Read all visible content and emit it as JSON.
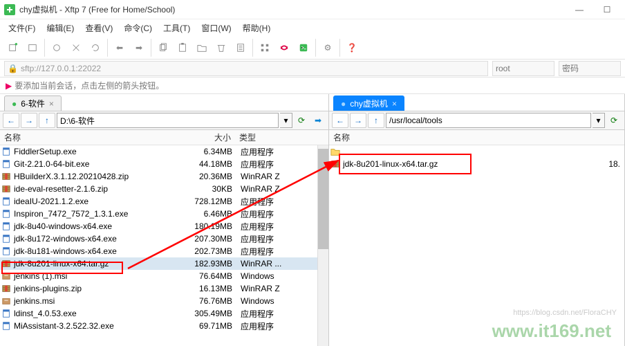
{
  "window": {
    "title": "chy虚拟机 - Xftp 7 (Free for Home/School)"
  },
  "menu": {
    "file": "文件(F)",
    "edit": "编辑(E)",
    "view": "查看(V)",
    "cmd": "命令(C)",
    "tools": "工具(T)",
    "window": "窗口(W)",
    "help": "帮助(H)"
  },
  "address": {
    "url": "sftp://127.0.0.1:22022",
    "user_placeholder": "root",
    "pass_placeholder": "密码"
  },
  "hint": "要添加当前会话，点击左侧的箭头按钮。",
  "left": {
    "tab": "6-软件",
    "path": "D:\\6-软件",
    "cols": {
      "name": "名称",
      "size": "大小",
      "type": "类型"
    },
    "files": [
      {
        "ico": "app",
        "name": "FiddlerSetup.exe",
        "size": "6.34MB",
        "type": "应用程序"
      },
      {
        "ico": "app",
        "name": "Git-2.21.0-64-bit.exe",
        "size": "44.18MB",
        "type": "应用程序"
      },
      {
        "ico": "rar",
        "name": "HBuilderX.3.1.12.20210428.zip",
        "size": "20.36MB",
        "type": "WinRAR Z"
      },
      {
        "ico": "rar",
        "name": "ide-eval-resetter-2.1.6.zip",
        "size": "30KB",
        "type": "WinRAR Z"
      },
      {
        "ico": "app",
        "name": "ideaIU-2021.1.2.exe",
        "size": "728.12MB",
        "type": "应用程序"
      },
      {
        "ico": "app",
        "name": "Inspiron_7472_7572_1.3.1.exe",
        "size": "6.46MB",
        "type": "应用程序"
      },
      {
        "ico": "app",
        "name": "jdk-8u40-windows-x64.exe",
        "size": "180.19MB",
        "type": "应用程序"
      },
      {
        "ico": "app",
        "name": "jdk-8u172-windows-x64.exe",
        "size": "207.30MB",
        "type": "应用程序"
      },
      {
        "ico": "app",
        "name": "jdk-8u181-windows-x64.exe",
        "size": "202.73MB",
        "type": "应用程序"
      },
      {
        "ico": "rar",
        "name": "jdk-8u201-linux-x64.tar.gz",
        "size": "182.93MB",
        "type": "WinRAR ...",
        "sel": true
      },
      {
        "ico": "msi",
        "name": "jenkins (1).msi",
        "size": "76.64MB",
        "type": "Windows"
      },
      {
        "ico": "rar",
        "name": "jenkins-plugins.zip",
        "size": "16.13MB",
        "type": "WinRAR Z"
      },
      {
        "ico": "msi",
        "name": "jenkins.msi",
        "size": "76.76MB",
        "type": "Windows"
      },
      {
        "ico": "app",
        "name": "ldinst_4.0.53.exe",
        "size": "305.49MB",
        "type": "应用程序"
      },
      {
        "ico": "app",
        "name": "MiAssistant-3.2.522.32.exe",
        "size": "69.71MB",
        "type": "应用程序"
      }
    ]
  },
  "right": {
    "tab": "chy虚拟机",
    "path": "/usr/local/tools",
    "cols": {
      "name": "名称",
      "size_cut": "18."
    },
    "files": [
      {
        "ico": "folder",
        "name": ""
      },
      {
        "ico": "rar",
        "name": "jdk-8u201-linux-x64.tar.gz",
        "size": "18."
      }
    ]
  },
  "watermark": "www.it169.net",
  "watermark2": "https://blog.csdn.net/FloraCHY"
}
